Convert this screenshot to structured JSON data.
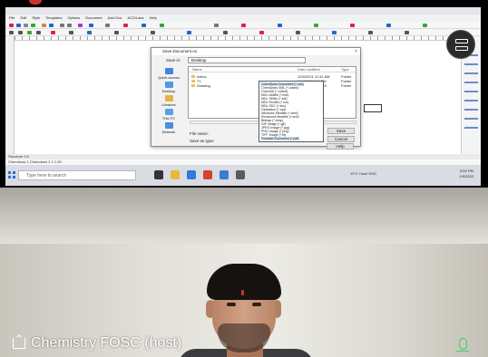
{
  "meeting": {
    "participant_name": "Chemistry FOSC (host)",
    "mic_color": "#3ad25a"
  },
  "shared_screen": {
    "menu": [
      "File",
      "Edit",
      "Style",
      "Templates",
      "Options",
      "Document",
      "Add-Ons",
      "ACD/Labs",
      "Help"
    ],
    "status_left": "Structure 2/4",
    "tabs": "Chemdraw 1  Chemdraw 2  1 1.00",
    "taskbar": {
      "search_placeholder": "Type here to search",
      "tray_text": "19°C Haze  ENG",
      "time": "5:52 PM",
      "date": "1/9/2022"
    }
  },
  "dialog": {
    "title": "Save Document As",
    "close": "×",
    "save_in_label": "Save in:",
    "save_in_value": "Desktop",
    "column_headers": [
      "Name",
      "Date modified",
      "Type"
    ],
    "files": [
      {
        "name": "Arbus",
        "date": "12/9/2021 11:41 AM",
        "type": "Folder"
      },
      {
        "name": "T1",
        "date": "1/9/2022 3:38 PM",
        "type": "Folder"
      },
      {
        "name": "Drawing",
        "date": "1/9/2022 3:40 PM",
        "type": "Folder"
      }
    ],
    "nav": [
      "Quick access",
      "Desktop",
      "Libraries",
      "This PC",
      "Network"
    ],
    "file_name_label": "File name:",
    "save_as_type_label": "Save as type:",
    "buttons": [
      "Save",
      "Cancel",
      "Help"
    ],
    "type_options": [
      "ChemDraw Document (*.cdx)",
      "ChemDraw XML (*.cdxml)",
      "Chem3D (*.c3xml)",
      "MDL Molfile (*.mol)",
      "MDL SDfile (*.sdf)",
      "MDL Rxnfile (*.rxn)",
      "MDL SKC (*.skc)",
      "Galvaston (*.xyz)",
      "Windows Metafile (*.wmf)",
      "Enhanced Metafile (*.emf)",
      "Bitmap (*.bmp)",
      "GIF Image (*.gif)",
      "JPEG Image (*.jpg)",
      "PNG Image (*.png)",
      "TIFF Image (*.tif)",
      "Portable Document (*.pdf)",
      "SVG Image (*.svg)"
    ]
  },
  "colors": {
    "accent": "#2b6fd6",
    "toolbar_bg": "#f6f6f7",
    "taskbar_bg": "#d9dce3"
  }
}
